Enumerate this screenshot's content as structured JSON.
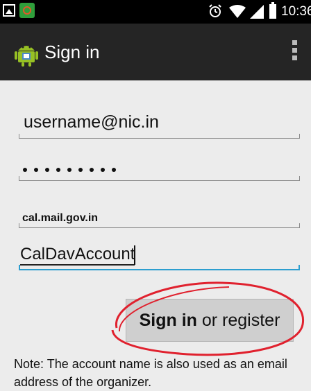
{
  "status_bar": {
    "time": "10:36",
    "icons": [
      "image-icon",
      "app-notification-icon",
      "alarm-icon",
      "wifi-icon",
      "signal-icon",
      "battery-icon"
    ]
  },
  "action_bar": {
    "title": "Sign in",
    "logo": "android-app-logo",
    "menu": "overflow-menu-icon"
  },
  "form": {
    "username": {
      "value": "username@nic.in"
    },
    "password": {
      "value": "•••••••••",
      "masked_length": 9
    },
    "server": {
      "value": "cal.mail.gov.in"
    },
    "account_name": {
      "value": "CalDavAccount"
    }
  },
  "signin_button": {
    "bold_label": "Sign in",
    "rest_label": " or register"
  },
  "note": "Note: The account name is also used as an email address of the organizer.",
  "colors": {
    "status_bar_bg": "#000000",
    "action_bar_bg": "#252525",
    "content_bg": "#ececec",
    "focus_underline": "#2c9ecf",
    "annotation_circle": "#e0212e",
    "button_bg": "#cfcfcf"
  }
}
